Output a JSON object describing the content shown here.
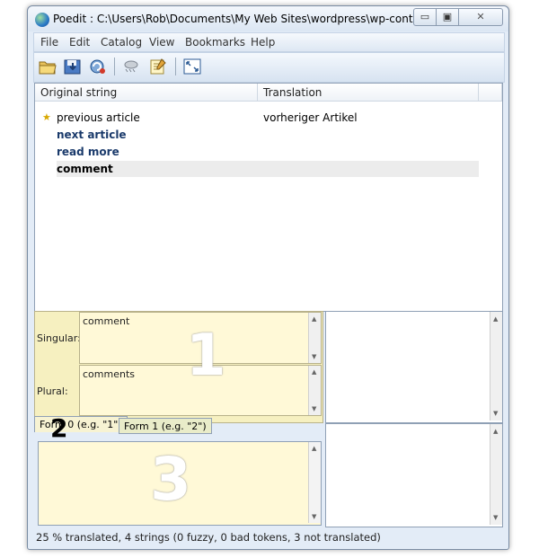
{
  "window": {
    "title": "Poedit : C:\\Users\\Rob\\Documents\\My Web Sites\\wordpress\\wp-content\\...",
    "min_label": "▭",
    "max_label": "▣",
    "close_label": "✕"
  },
  "menu": [
    "File",
    "Edit",
    "Catalog",
    "View",
    "Bookmarks",
    "Help"
  ],
  "toolbar": [
    "open-icon",
    "save-icon",
    "update-icon",
    "validate-icon",
    "comment-icon",
    "fullscreen-icon"
  ],
  "columns": [
    "Original string",
    "Translation"
  ],
  "rows": [
    {
      "original": "previous article",
      "translation": "vorheriger Artikel",
      "starred": true
    },
    {
      "original": "next article",
      "translation": ""
    },
    {
      "original": "read more",
      "translation": ""
    },
    {
      "original": "comment",
      "translation": ""
    }
  ],
  "editor": {
    "singular_label": "Singular:",
    "singular_text": "comment",
    "plural_label": "Plural:",
    "plural_text": "comments",
    "annotation_1": "1",
    "annotation_2": "2",
    "annotation_3": "3",
    "tabs": [
      "Form 0 (e.g. \"1\")",
      "Form 1 (e.g. \"2\")"
    ]
  },
  "status": "25 % translated, 4 strings (0 fuzzy, 0 bad tokens, 3 not translated)",
  "colors": {
    "source_bg": "#f6f0c0",
    "translation_bg": "#fff9d7",
    "frame": "#e3ecf7"
  }
}
